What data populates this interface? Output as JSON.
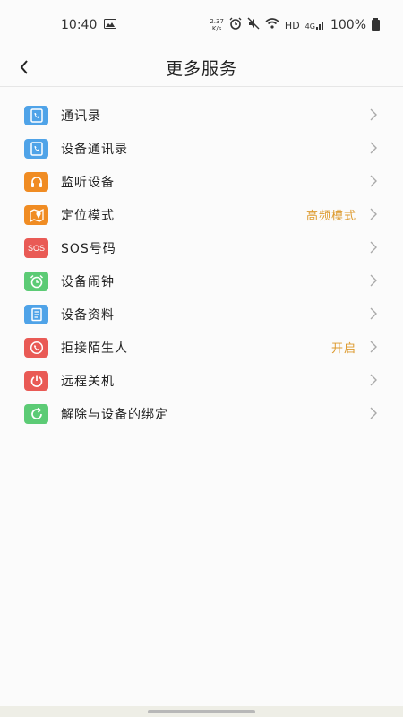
{
  "status_bar": {
    "time": "10:40",
    "net_speed_value": "2.37",
    "net_speed_unit": "K/s",
    "signal_label": "HD",
    "network_label": "4G",
    "battery": "100%"
  },
  "header": {
    "title": "更多服务"
  },
  "menu": {
    "items": [
      {
        "label": "通讯录",
        "value": "",
        "icon": "contacts-icon",
        "color": "#4fa3e8"
      },
      {
        "label": "设备通讯录",
        "value": "",
        "icon": "device-contacts-icon",
        "color": "#4fa3e8"
      },
      {
        "label": "监听设备",
        "value": "",
        "icon": "headphones-icon",
        "color": "#f08c23"
      },
      {
        "label": "定位模式",
        "value": "高频模式",
        "icon": "location-map-icon",
        "color": "#f08c23"
      },
      {
        "label": "SOS号码",
        "value": "",
        "icon": "sos-icon",
        "color": "#e95a55",
        "icon_text": "SOS"
      },
      {
        "label": "设备闹钟",
        "value": "",
        "icon": "alarm-clock-icon",
        "color": "#5ccb75"
      },
      {
        "label": "设备资料",
        "value": "",
        "icon": "document-icon",
        "color": "#4fa3e8"
      },
      {
        "label": "拒接陌生人",
        "value": "开启",
        "icon": "reject-call-icon",
        "color": "#e95a55"
      },
      {
        "label": "远程关机",
        "value": "",
        "icon": "power-icon",
        "color": "#e95a55"
      },
      {
        "label": "解除与设备的绑定",
        "value": "",
        "icon": "unbind-icon",
        "color": "#5ccb75"
      }
    ]
  }
}
